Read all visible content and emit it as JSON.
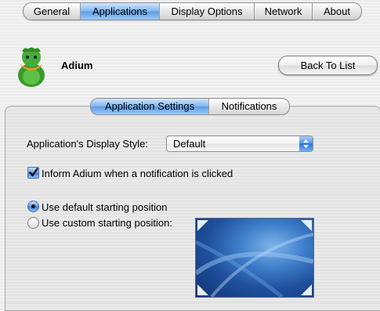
{
  "top_tabs": [
    "General",
    "Applications",
    "Display Options",
    "Network",
    "About"
  ],
  "top_tabs_selected": "Applications",
  "app": {
    "name": "Adium",
    "icon": "adium-duck-icon"
  },
  "back_button": "Back To List",
  "sub_tabs": [
    "Application Settings",
    "Notifications"
  ],
  "sub_tabs_selected": "Application Settings",
  "display_style": {
    "label": "Application's Display Style:",
    "value": "Default"
  },
  "inform_checkbox": {
    "label": "Inform Adium when a notification is clicked",
    "checked": true
  },
  "position": {
    "default_label": "Use default starting position",
    "custom_label": "Use custom starting position:",
    "selected": "default"
  },
  "colors": {
    "accent": "#5e9be4"
  }
}
